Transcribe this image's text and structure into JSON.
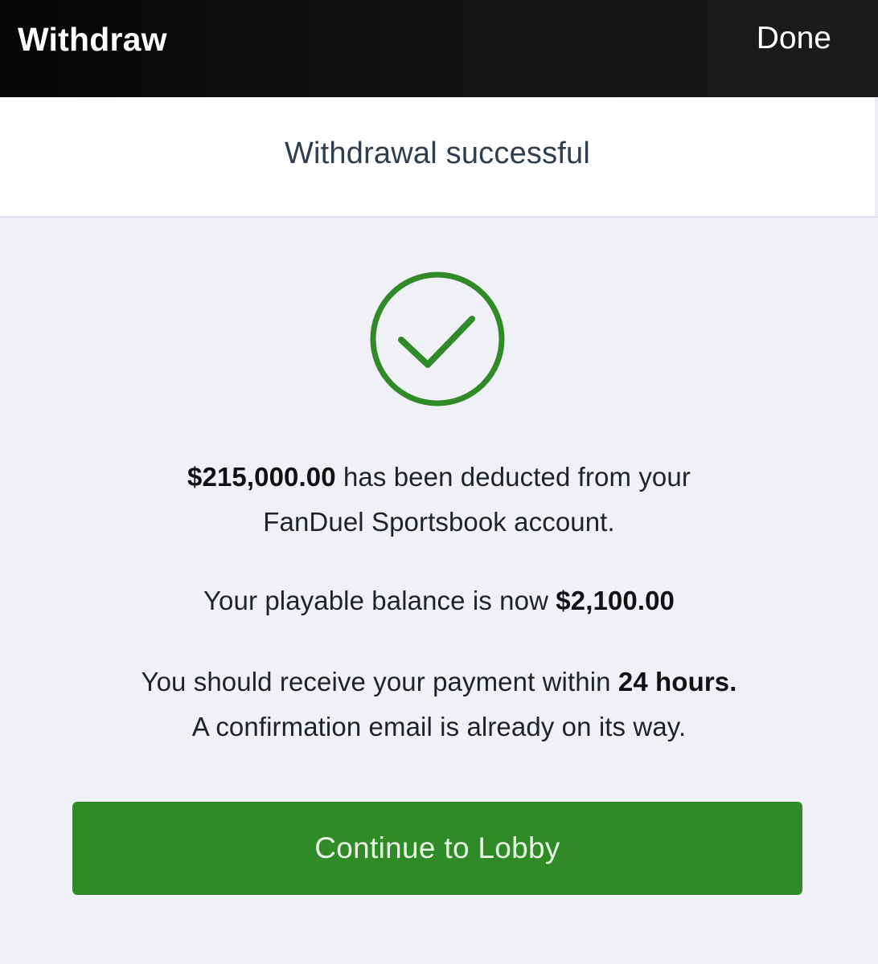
{
  "header": {
    "title": "Withdraw",
    "done_label": "Done"
  },
  "subheader": {
    "title": "Withdrawal successful"
  },
  "status_icon": "check-circle-icon",
  "message": {
    "amount": "$215,000.00",
    "deducted_line_1": "has been deducted from your",
    "deducted_line_2": "FanDuel Sportsbook account.",
    "balance_prefix": "Your playable balance is now",
    "balance": "$2,100.00",
    "payment_prefix": "You should receive your payment within",
    "payment_time": "24 hours.",
    "confirmation": "A confirmation email is already on its way."
  },
  "continue_button": {
    "label": "Continue to Lobby"
  },
  "colors": {
    "accent_green": "#2f8a27",
    "header_bg": "#0a0a0a",
    "page_bg": "#f0f1f7"
  }
}
